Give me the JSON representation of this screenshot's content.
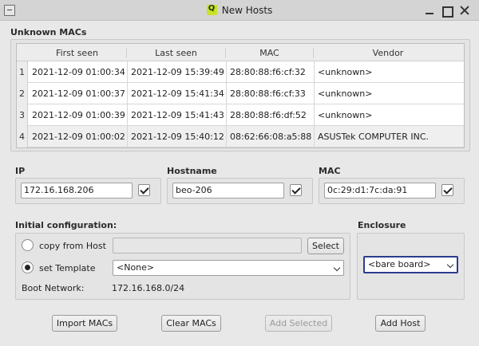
{
  "window": {
    "title": "New Hosts"
  },
  "unknown_macs": {
    "label": "Unknown MACs",
    "columns": [
      "First seen",
      "Last seen",
      "MAC",
      "Vendor"
    ],
    "rows": [
      {
        "num": "1",
        "first_seen": "2021-12-09 01:00:34",
        "last_seen": "2021-12-09 15:39:49",
        "mac": "28:80:88:f6:cf:32",
        "vendor": "<unknown>"
      },
      {
        "num": "2",
        "first_seen": "2021-12-09 01:00:37",
        "last_seen": "2021-12-09 15:41:34",
        "mac": "28:80:88:f6:cf:33",
        "vendor": "<unknown>"
      },
      {
        "num": "3",
        "first_seen": "2021-12-09 01:00:39",
        "last_seen": "2021-12-09 15:41:43",
        "mac": "28:80:88:f6:df:52",
        "vendor": "<unknown>"
      },
      {
        "num": "4",
        "first_seen": "2021-12-09 01:00:02",
        "last_seen": "2021-12-09 15:40:12",
        "mac": "08:62:66:08:a5:88",
        "vendor": "ASUSTek COMPUTER INC."
      }
    ]
  },
  "ip": {
    "label": "IP",
    "value": "172.16.168.206"
  },
  "hostname": {
    "label": "Hostname",
    "value": "beo-206"
  },
  "mac": {
    "label": "MAC",
    "value": "0c:29:d1:7c:da:91"
  },
  "initial_config": {
    "label": "Initial configuration:",
    "copy_from_host_label": "copy from Host",
    "select_button": "Select",
    "set_template_label": "set Template",
    "template_value": "<None>",
    "boot_network_label": "Boot Network:",
    "boot_network_value": "172.16.168.0/24"
  },
  "enclosure": {
    "label": "Enclosure",
    "value": "<bare board>"
  },
  "buttons": {
    "import_macs": "Import MACs",
    "clear_macs": "Clear MACs",
    "add_selected": "Add Selected",
    "add_host": "Add Host"
  },
  "icons": {
    "window_menu": "window-menu-icon",
    "app_logo": "q-logo-icon",
    "minimize": "minimize-icon",
    "maximize": "maximize-icon",
    "close": "close-icon"
  }
}
